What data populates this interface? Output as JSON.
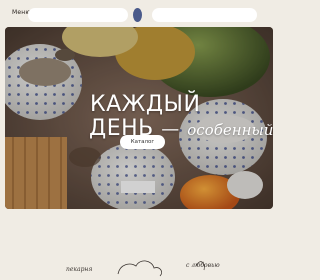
{
  "header": {
    "menu_label": "Меню"
  },
  "hero": {
    "title_line1": "КАЖДЫЙ",
    "title_line2_word": "ДЕНЬ",
    "title_line2_dash": "—",
    "title_line2_script": "особенный",
    "catalog_button_label": "Каталог"
  },
  "footer": {
    "script_left": "пекарня",
    "script_right": "с любовью"
  },
  "colors": {
    "background": "#f0ece4",
    "logo_accent": "#4a5a8a",
    "hero_text": "#ffffff"
  }
}
